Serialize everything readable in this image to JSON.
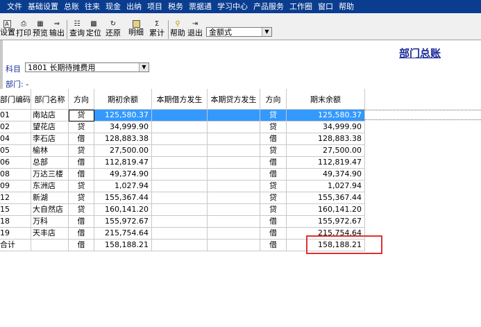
{
  "menu": [
    "文件",
    "基础设置",
    "总账",
    "往来",
    "现金",
    "出纳",
    "项目",
    "税务",
    "票据通",
    "学习中心",
    "产品服务",
    "工作圈",
    "窗口",
    "帮助"
  ],
  "toolbar": {
    "buttons": [
      {
        "id": "settings",
        "label": "设置",
        "icon": "gear-icon"
      },
      {
        "id": "print",
        "label": "打印",
        "icon": "printer-icon"
      },
      {
        "id": "preview",
        "label": "预览",
        "icon": "preview-icon"
      },
      {
        "id": "export",
        "label": "输出",
        "icon": "export-icon"
      },
      {
        "id": "query",
        "label": "查询",
        "icon": "query-icon"
      },
      {
        "id": "locate",
        "label": "定位",
        "icon": "locate-icon"
      },
      {
        "id": "restore",
        "label": "还原",
        "icon": "restore-icon"
      },
      {
        "id": "detail",
        "label": "明细",
        "icon": "detail-icon"
      },
      {
        "id": "cumulative",
        "label": "累计",
        "icon": "sigma-icon"
      },
      {
        "id": "help",
        "label": "帮助",
        "icon": "help-icon"
      },
      {
        "id": "exit",
        "label": "退出",
        "icon": "exit-icon"
      }
    ],
    "format_select": "金额式"
  },
  "report": {
    "title": "部门总账",
    "subject_label": "科目",
    "subject_value": "1801 长期待摊费用",
    "dept_label": "部门:",
    "dept_value": "-"
  },
  "table": {
    "headers": [
      "部门编码",
      "部门名称",
      "方向",
      "期初余额",
      "本期借方发生",
      "本期贷方发生",
      "方向",
      "期末余额"
    ],
    "rows": [
      {
        "code": "01",
        "name": "南站店",
        "dir1": "贷",
        "opening": "125,580.37",
        "debit": "",
        "credit": "",
        "dir2": "贷",
        "closing": "125,580.37"
      },
      {
        "code": "02",
        "name": "望花店",
        "dir1": "贷",
        "opening": "34,999.90",
        "debit": "",
        "credit": "",
        "dir2": "贷",
        "closing": "34,999.90"
      },
      {
        "code": "04",
        "name": "李石店",
        "dir1": "借",
        "opening": "128,883.38",
        "debit": "",
        "credit": "",
        "dir2": "借",
        "closing": "128,883.38"
      },
      {
        "code": "05",
        "name": "榆林",
        "dir1": "贷",
        "opening": "27,500.00",
        "debit": "",
        "credit": "",
        "dir2": "贷",
        "closing": "27,500.00"
      },
      {
        "code": "06",
        "name": "总部",
        "dir1": "借",
        "opening": "112,819.47",
        "debit": "",
        "credit": "",
        "dir2": "借",
        "closing": "112,819.47"
      },
      {
        "code": "08",
        "name": "万达三楼",
        "dir1": "借",
        "opening": "49,374.90",
        "debit": "",
        "credit": "",
        "dir2": "借",
        "closing": "49,374.90"
      },
      {
        "code": "09",
        "name": "东洲店",
        "dir1": "贷",
        "opening": "1,027.94",
        "debit": "",
        "credit": "",
        "dir2": "贷",
        "closing": "1,027.94"
      },
      {
        "code": "12",
        "name": "新湖",
        "dir1": "贷",
        "opening": "155,367.44",
        "debit": "",
        "credit": "",
        "dir2": "贷",
        "closing": "155,367.44"
      },
      {
        "code": "15",
        "name": "大自然店",
        "dir1": "贷",
        "opening": "160,141.20",
        "debit": "",
        "credit": "",
        "dir2": "贷",
        "closing": "160,141.20"
      },
      {
        "code": "18",
        "name": "万科",
        "dir1": "借",
        "opening": "155,972.67",
        "debit": "",
        "credit": "",
        "dir2": "借",
        "closing": "155,972.67"
      },
      {
        "code": "19",
        "name": "天丰店",
        "dir1": "借",
        "opening": "215,754.64",
        "debit": "",
        "credit": "",
        "dir2": "借",
        "closing": "215,754.64"
      },
      {
        "code": "合计",
        "name": "",
        "dir1": "借",
        "opening": "158,188.21",
        "debit": "",
        "credit": "",
        "dir2": "借",
        "closing": "158,188.21"
      }
    ]
  },
  "colors": {
    "menu_bg": "#0a3d8f",
    "selection": "#3399ff",
    "title": "#1a2a9a",
    "highlight_box": "#e03030"
  }
}
